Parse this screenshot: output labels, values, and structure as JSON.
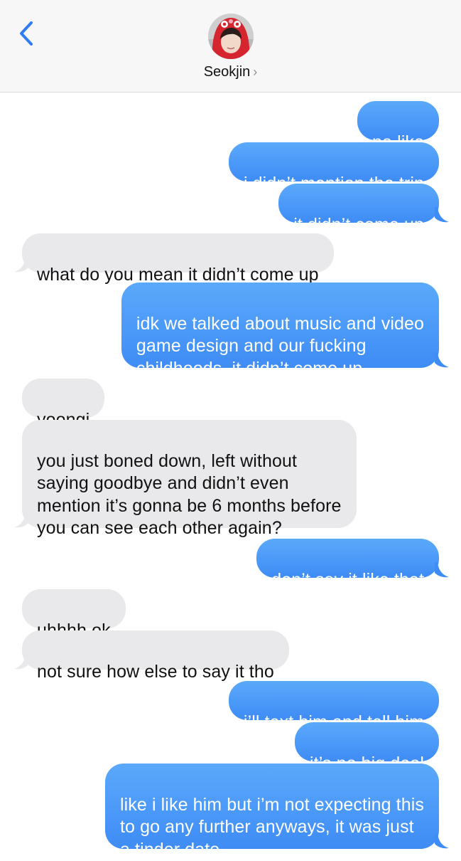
{
  "header": {
    "back_icon": "chevron-left-icon",
    "contact_name": "Seokjin",
    "chevron": "›",
    "accent": "#2f7cf6"
  },
  "colors": {
    "sent_bubble": "#4a98f7",
    "received_bubble": "#e9e9eb",
    "header_bg": "#f7f7f7"
  },
  "messages": [
    {
      "from": "me",
      "text": "no like"
    },
    {
      "from": "me",
      "text": "i didn’t mention the trip"
    },
    {
      "from": "me",
      "text": "it didn’t come up"
    },
    {
      "from": "them",
      "text": "what do you mean it didn’t come up"
    },
    {
      "from": "me",
      "text": "idk we talked about music and video\ngame design and our fucking\nchildhoods, it didn’t come up"
    },
    {
      "from": "them",
      "text": "yoongi"
    },
    {
      "from": "them",
      "text": "you just boned down, left without\nsaying goodbye and didn’t even\nmention it’s gonna be 6 months before\nyou can see each other again?"
    },
    {
      "from": "me",
      "text": "don’t say it like that"
    },
    {
      "from": "them",
      "text": "uhhhh ok"
    },
    {
      "from": "them",
      "text": "not sure how else to say it tho"
    },
    {
      "from": "me",
      "text": "i’ll text him and tell him"
    },
    {
      "from": "me",
      "text": "it’s no big deal"
    },
    {
      "from": "me",
      "text": "like i like him but i’m not expecting this\nto go any further anyways, it was just\na tinder date"
    }
  ]
}
